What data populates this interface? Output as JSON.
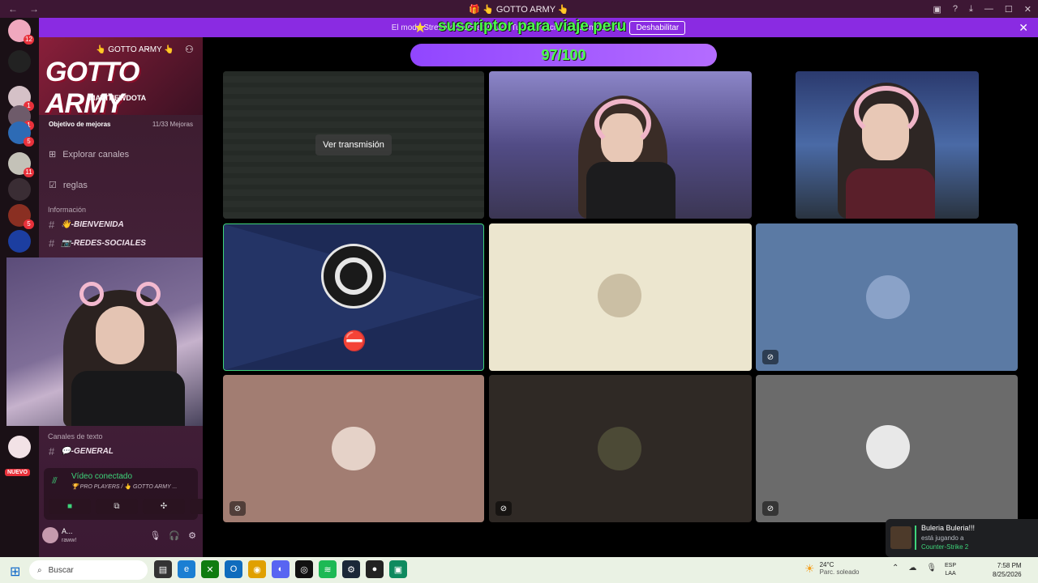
{
  "window": {
    "title": "🎁 👆 GOTTO ARMY 👆",
    "minimize": "—",
    "maximize": "☐",
    "close": "✕"
  },
  "banner": {
    "text": "El modo Streamer está activado. Tu información no se mostrará.",
    "button": "Deshabilitar"
  },
  "stream_overlay": {
    "subscription_text": "suscriptor para viaje peru",
    "goal_current": 97,
    "goal_total": 100,
    "goal_text": "97/100"
  },
  "server": {
    "name": "👆 GOTTO ARMY 👆",
    "banner_art": "GOTTO ARMY",
    "banner_sub": "MATTHEWDOTA",
    "boost_label": "Objetivo de mejoras",
    "boost_progress": "11/33 Mejoras",
    "links": [
      {
        "label": "Explorar canales",
        "icon": "compass-icon"
      },
      {
        "label": "reglas",
        "icon": "checkbox-icon"
      }
    ],
    "category_info": "Información",
    "info_channels": [
      "👋-BIENVENIDA",
      "📷-REDES-SOCIALES"
    ],
    "category_text": "Canales de texto",
    "text_channels": [
      "💬-GENERAL"
    ]
  },
  "rail": {
    "badges": [
      "12",
      "1",
      "1",
      "5",
      "11",
      "5"
    ],
    "new_label": "NUEVO"
  },
  "voice": {
    "status": "Vídeo conectado",
    "channel": "🏆 PRO PLAYERS / 👆 GOTTO ARMY ..."
  },
  "user": {
    "name": "A...",
    "status": "raww!"
  },
  "stage": {
    "watch_stream_button": "Ver transmisión",
    "tile_colors": {
      "cream": "#ece6cf",
      "blue": "#5b7aa4",
      "rose": "#a27d72",
      "dark": "#2f2925",
      "gray": "#6b6b6b"
    }
  },
  "toast": {
    "name": "Buleria Buleria!!!",
    "activity": "está jugando a",
    "game": "Counter-Strike 2"
  },
  "taskbar": {
    "search_placeholder": "Buscar",
    "weather_temp": "24°C",
    "weather_desc": "Parc. soleado",
    "lang_top": "ESP",
    "lang_bottom": "LAA",
    "time": "7:58 PM",
    "date": "8/25/2026"
  }
}
